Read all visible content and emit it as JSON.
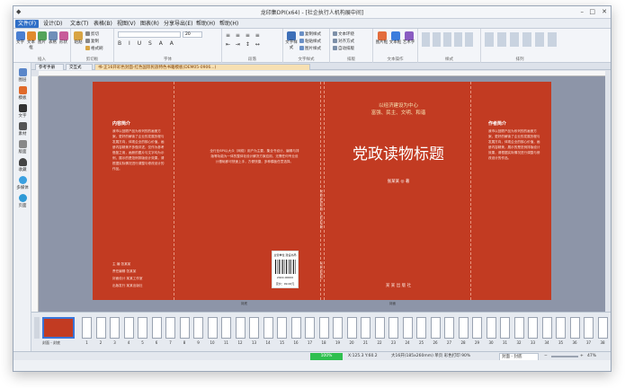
{
  "window": {
    "title": "龙印集DPI(x64) - [社企执行人机构展中间]"
  },
  "menu": [
    "文件(F)",
    "设计(D)",
    "文本(T)",
    "表格(B)",
    "视图(V)",
    "图表(R)",
    "分享导出(E)",
    "帮助(H)",
    "帮助(H)"
  ],
  "ribbon": {
    "groups": [
      {
        "label": "插入",
        "buttons": [
          "文字",
          "文本框",
          "图片",
          "表格",
          "形状"
        ]
      },
      {
        "label": "剪切板",
        "buttons": [
          "粘贴",
          "剪切",
          "复制",
          "格式刷"
        ]
      },
      {
        "label": "字体",
        "font_size": "20"
      },
      {
        "label": "段落"
      },
      {
        "label": "文字样式",
        "buttons": [
          "文字样式",
          "复制样式",
          "粘贴样式",
          "图片样式"
        ]
      },
      {
        "label": "排版",
        "buttons": [
          "文本环绕",
          "对齐方式",
          "自动排版"
        ]
      },
      {
        "label": "文本操作",
        "buttons": [
          "图片框",
          "文本框",
          "艺术字"
        ]
      },
      {
        "label": "样式"
      },
      {
        "label": "排列"
      }
    ]
  },
  "leftbar": [
    "图层",
    "模板",
    "文字",
    "素材",
    "版面",
    "收藏",
    "多媒体",
    "页面"
  ],
  "tabs": [
    "参考手册",
    "交互式",
    "书-正16开彩色封面-红色国际民族特色书籍模板(DEM05-0906...)"
  ],
  "cover": {
    "back_title": "内容简介",
    "back_text": "我市以回顾产品为系列的的画册方案，更好的解读了企业的发展历程与发展方向，体现企业的核心价值，画册内容精美不多做评述，仅作为参考借鉴之用，画册的图片与文字均为示例，展示的是范例排版设计效果，请根据实际情况进行调整与修改设计的作品。",
    "info": [
      "主 编  张某某",
      "责任编辑  张某某",
      "封面设计  某某工作室",
      "出版发行  某某出版社"
    ],
    "center_text": "全行业BPI以大众（网络）用户为主要，集全书设计，编辑与排版等功能为一体的整体化设计解决方案应用，无需任何专业设计基础即可快速上手，方便快捷，多种模板任意选择。",
    "barcode_top": "主管单位  建设书局",
    "barcode_num": "2022-00000",
    "price": "定价：99.00元",
    "spine": "党政读物标题 · 张某某 著",
    "spine_pub": "某某出版社",
    "front_motto1": "以经济建设为中心",
    "front_motto2": "富强、民主、文明、和谐",
    "front_title": "党政读物标题",
    "front_author": "张某某 ◎ 著",
    "front_pub": "某 某 出 版 社",
    "author_title": "作者简介",
    "author_text": "我市以回顾产品为系列的的画册方案，更好的解读了企业的发展历程与发展方向，体现企业的核心价值，画册内容精美，展示的是范例排版设计效果，请根据实际情况进行调整与修改设计的作品。",
    "label_back": "封底",
    "label_front": "封面"
  },
  "pages": {
    "first_label": "封面 - 封底",
    "numbers": [
      "1",
      "2",
      "3",
      "4",
      "5",
      "6",
      "7",
      "8",
      "9",
      "10",
      "11",
      "12",
      "13",
      "14",
      "15",
      "16",
      "17",
      "18",
      "19",
      "20",
      "21",
      "22",
      "23",
      "24",
      "25",
      "26",
      "27",
      "28",
      "29",
      "30",
      "31",
      "32",
      "33",
      "34",
      "35",
      "36",
      "37",
      "38"
    ]
  },
  "status": {
    "zoom_bar": "100%",
    "coords": "X:125.3  Y:60.2",
    "size_info": "大16开(185x260mm)  单页  彩色打印  90%",
    "page_select": "封面 - 封底",
    "zoom": "47%"
  },
  "colors": {
    "cover_red": "#c23b22",
    "accent": "#2f6fc7",
    "status_green": "#2fbf4f"
  }
}
